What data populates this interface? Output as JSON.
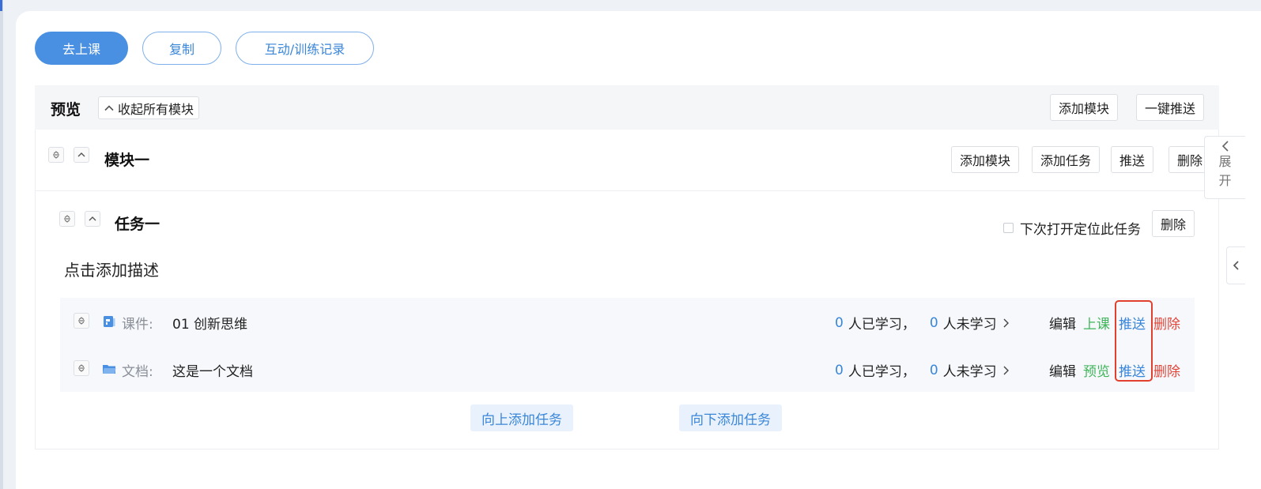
{
  "top_buttons": {
    "go_to_class": "去上课",
    "copy": "复制",
    "records": "互动/训练记录"
  },
  "preview_bar": {
    "title": "预览",
    "collapse_all": "收起所有模块",
    "add_module": "添加模块",
    "push_all": "一键推送"
  },
  "module": {
    "title": "模块一",
    "add_module": "添加模块",
    "add_task": "添加任务",
    "push": "推送",
    "delete": "删除"
  },
  "task": {
    "title": "任务一",
    "locate_label": "下次打开定位此任务",
    "delete": "删除",
    "description": "点击添加描述",
    "add_above": "向上添加任务",
    "add_below": "向下添加任务"
  },
  "items": [
    {
      "type_label": "课件:",
      "icon": "courseware-icon",
      "name": "01 创新思维",
      "learned_count": "0",
      "learned_text": "人已学习，",
      "unlearned_count": "0",
      "unlearned_text": "人未学习",
      "action_edit": "编辑",
      "action_green": "上课",
      "action_push": "推送",
      "action_delete": "删除"
    },
    {
      "type_label": "文档:",
      "icon": "folder-icon",
      "name": "这是一个文档",
      "learned_count": "0",
      "learned_text": "人已学习，",
      "unlearned_count": "0",
      "unlearned_text": "人未学习",
      "action_edit": "编辑",
      "action_green": "预览",
      "action_push": "推送",
      "action_delete": "删除"
    }
  ],
  "side_panel": {
    "expand_char_1": "展",
    "expand_char_2": "开"
  },
  "colors": {
    "primary": "#4a90e2",
    "link_blue": "#3a86d8",
    "green": "#3fb55a",
    "red": "#e0463a",
    "highlight_red": "#e0402d"
  }
}
